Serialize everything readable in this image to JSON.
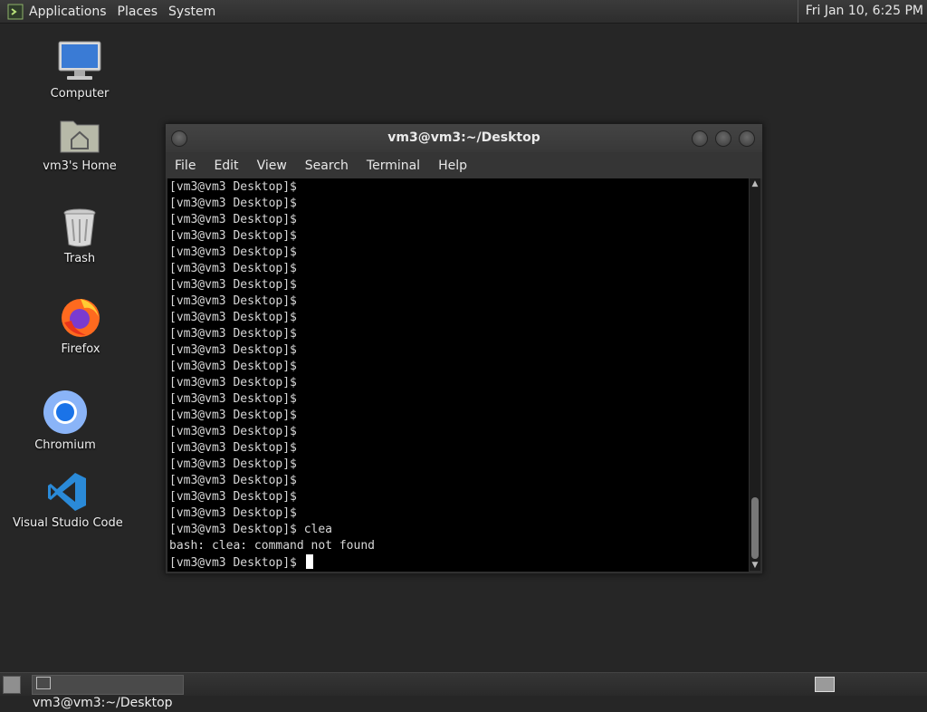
{
  "top_panel": {
    "menus": [
      "Applications",
      "Places",
      "System"
    ],
    "clock": "Fri Jan 10,  6:25 PM"
  },
  "desktop_icons": [
    {
      "label": "Computer",
      "icon": "computer-icon"
    },
    {
      "label": "vm3's Home",
      "icon": "home-folder-icon"
    },
    {
      "label": "Trash",
      "icon": "trash-icon"
    },
    {
      "label": "Firefox",
      "icon": "firefox-icon"
    },
    {
      "label": "Chromium",
      "icon": "chromium-icon"
    },
    {
      "label": "Visual Studio Code",
      "icon": "vscode-icon"
    }
  ],
  "terminal": {
    "title": "vm3@vm3:~/Desktop",
    "menu": [
      "File",
      "Edit",
      "View",
      "Search",
      "Terminal",
      "Help"
    ],
    "lines": [
      "[vm3@vm3 Desktop]$",
      "[vm3@vm3 Desktop]$",
      "[vm3@vm3 Desktop]$",
      "[vm3@vm3 Desktop]$",
      "[vm3@vm3 Desktop]$",
      "[vm3@vm3 Desktop]$",
      "[vm3@vm3 Desktop]$",
      "[vm3@vm3 Desktop]$",
      "[vm3@vm3 Desktop]$",
      "[vm3@vm3 Desktop]$",
      "[vm3@vm3 Desktop]$",
      "[vm3@vm3 Desktop]$",
      "[vm3@vm3 Desktop]$",
      "[vm3@vm3 Desktop]$",
      "[vm3@vm3 Desktop]$",
      "[vm3@vm3 Desktop]$",
      "[vm3@vm3 Desktop]$",
      "[vm3@vm3 Desktop]$",
      "[vm3@vm3 Desktop]$",
      "[vm3@vm3 Desktop]$",
      "[vm3@vm3 Desktop]$",
      "[vm3@vm3 Desktop]$ clea",
      "bash: clea: command not found"
    ],
    "prompt": "[vm3@vm3 Desktop]$ "
  },
  "taskbar": {
    "task_label": "vm3@vm3:~/Desktop"
  }
}
